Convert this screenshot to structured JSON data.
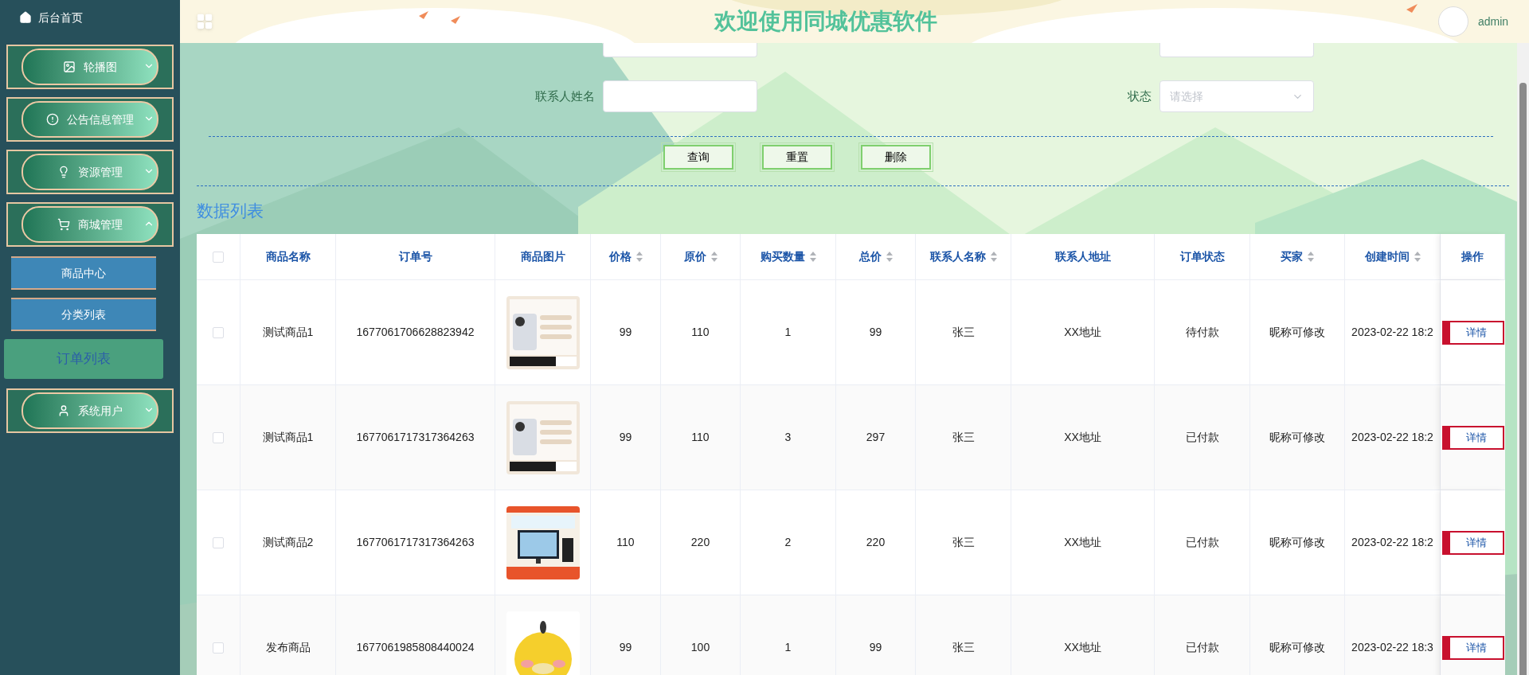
{
  "sidebar": {
    "home": "后台首页",
    "items": [
      {
        "label": "轮播图",
        "expanded": false
      },
      {
        "label": "公告信息管理",
        "expanded": false
      },
      {
        "label": "资源管理",
        "expanded": false
      },
      {
        "label": "商城管理",
        "expanded": true,
        "children": [
          {
            "label": "商品中心",
            "selected": false
          },
          {
            "label": "分类列表",
            "selected": false
          },
          {
            "label": "订单列表",
            "selected": true
          }
        ]
      },
      {
        "label": "系统用户",
        "expanded": false
      }
    ]
  },
  "header": {
    "title": "欢迎使用同城优惠软件",
    "user": "admin"
  },
  "search": {
    "fields": [
      {
        "kind": "input"
      },
      {
        "kind": "input"
      },
      {
        "label": "联系人姓名",
        "kind": "input"
      },
      {
        "label": "状态",
        "kind": "select",
        "placeholder": "请选择"
      }
    ],
    "buttons": [
      "查询",
      "重置",
      "删除"
    ]
  },
  "list_title": "数据列表",
  "table": {
    "select_all_checked": false,
    "columns": [
      {
        "label": "商品名称",
        "sortable": false
      },
      {
        "label": "订单号",
        "sortable": false
      },
      {
        "label": "商品图片",
        "sortable": false
      },
      {
        "label": "价格",
        "sortable": true
      },
      {
        "label": "原价",
        "sortable": true
      },
      {
        "label": "购买数量",
        "sortable": true
      },
      {
        "label": "总价",
        "sortable": true
      },
      {
        "label": "联系人名称",
        "sortable": true
      },
      {
        "label": "联系人地址",
        "sortable": false
      },
      {
        "label": "订单状态",
        "sortable": false
      },
      {
        "label": "买家",
        "sortable": true
      },
      {
        "label": "创建时间",
        "sortable": true
      },
      {
        "label": "操作",
        "sortable": false
      }
    ],
    "rows": [
      {
        "checked": false,
        "name": "测试商品1",
        "order_no": "1677061706628823942",
        "price": "99",
        "original_price": "110",
        "quantity": "1",
        "total": "99",
        "contact": "张三",
        "address": "XX地址",
        "status": "待付款",
        "buyer": "昵称可修改",
        "created": "2023-02-22 18:2",
        "action": "详情"
      },
      {
        "checked": false,
        "name": "测试商品1",
        "order_no": "1677061717317364263",
        "price": "99",
        "original_price": "110",
        "quantity": "3",
        "total": "297",
        "contact": "张三",
        "address": "XX地址",
        "status": "已付款",
        "buyer": "昵称可修改",
        "created": "2023-02-22 18:2",
        "action": "详情"
      },
      {
        "checked": false,
        "name": "测试商品2",
        "order_no": "1677061717317364263",
        "price": "110",
        "original_price": "220",
        "quantity": "2",
        "total": "220",
        "contact": "张三",
        "address": "XX地址",
        "status": "已付款",
        "buyer": "昵称可修改",
        "created": "2023-02-22 18:2",
        "action": "详情"
      },
      {
        "checked": false,
        "name": "发布商品",
        "order_no": "1677061985808440024",
        "price": "99",
        "original_price": "100",
        "quantity": "1",
        "total": "99",
        "contact": "张三",
        "address": "XX地址",
        "status": "已付款",
        "buyer": "昵称可修改",
        "created": "2023-02-22 18:3",
        "action": "详情"
      }
    ]
  }
}
